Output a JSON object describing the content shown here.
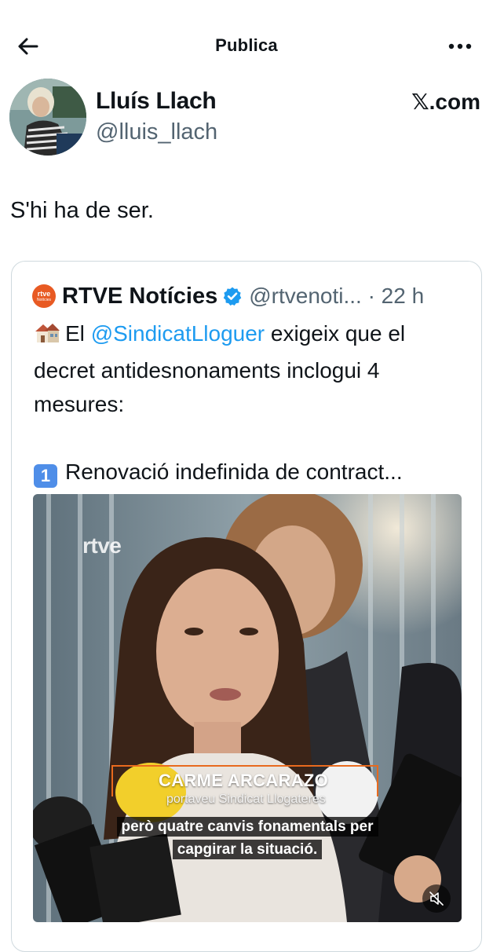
{
  "header": {
    "title": "Publica"
  },
  "author": {
    "name": "Lluís Llach",
    "handle": "@lluis_llach",
    "source": "𝕏.com"
  },
  "tweet": {
    "text": "S'hi ha de ser."
  },
  "quote": {
    "name": "RTVE Notícies",
    "handle_time": "@rtvenoti... · 22 h",
    "logo_line1": "rtve",
    "logo_line2": "Notícies",
    "text_before_mention": "El ",
    "mention": "@SindicatLloguer",
    "text_after_mention": " exigeix que el decret antidesnonaments inclogui 4 mesures:",
    "item_number": "1",
    "item_text": "Renovació indefinida de contract..."
  },
  "video": {
    "watermark": "rtve",
    "lower_third_name": "CARME ARCARAZO",
    "lower_third_role": "portaveu Sindicat Llogateres",
    "subtitle_line1": "però quatre canvis fonamentals per",
    "subtitle_line2": "capgirar la situació.",
    "muted": true
  },
  "colors": {
    "accent": "#1d9bf0",
    "text": "#0f1419",
    "secondary": "#536471",
    "border": "#cfd9de",
    "brand_orange": "#e85a23"
  }
}
